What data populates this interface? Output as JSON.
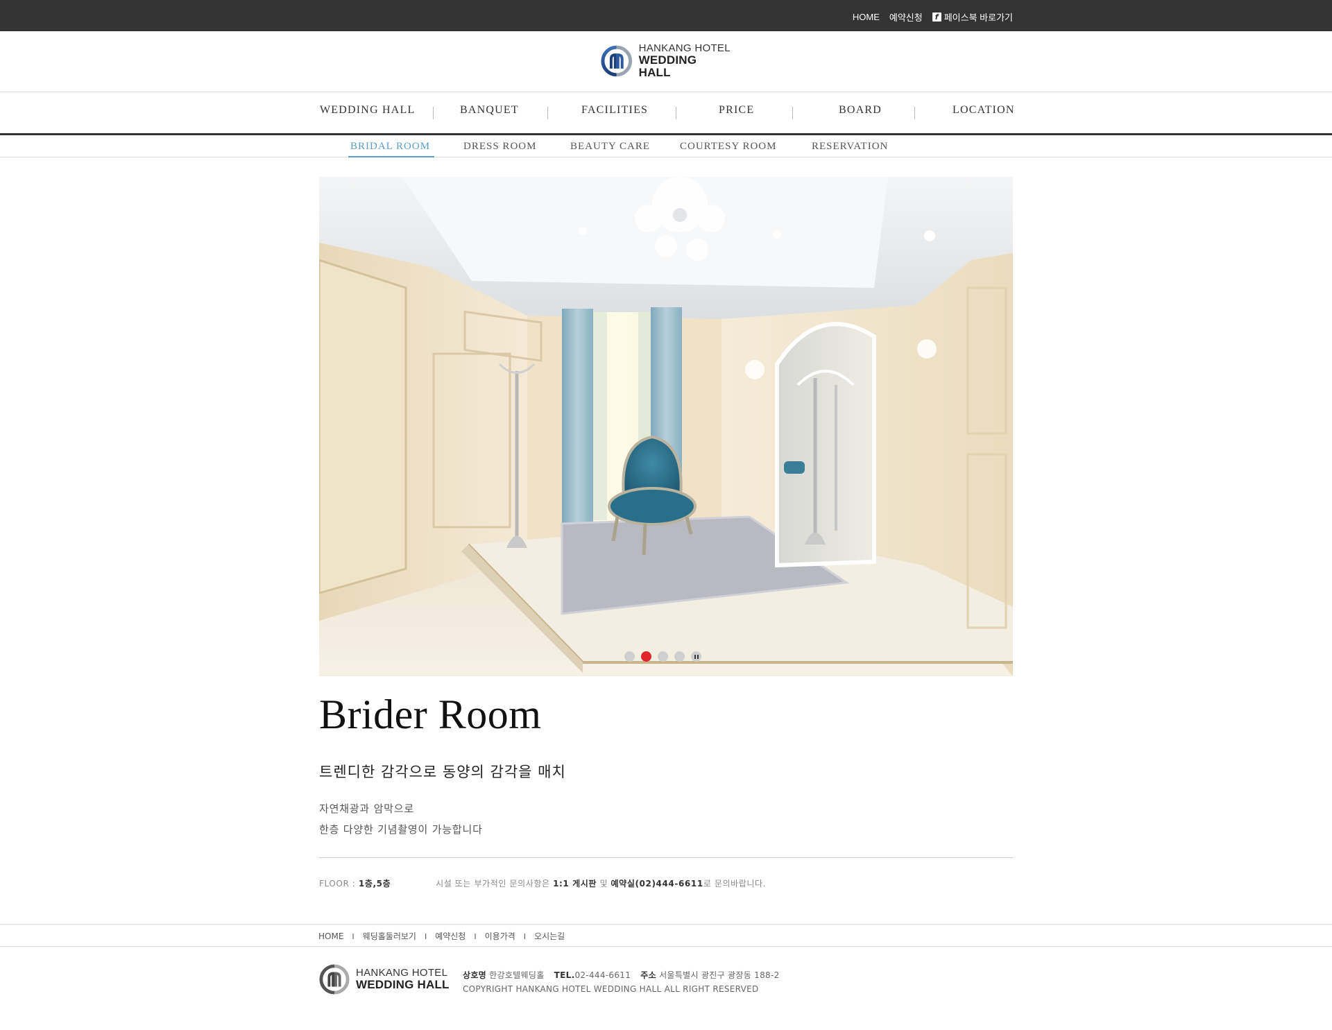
{
  "topbar": {
    "home": "HOME",
    "reservation": "예약신청",
    "facebook_icon": "f",
    "facebook": "페이스북 바로가기"
  },
  "brand": {
    "line1": "HANKANG HOTEL",
    "line2": "WEDDING HALL"
  },
  "main_nav": [
    "WEDDING HALL",
    "BANQUET",
    "FACILITIES",
    "PRICE",
    "BOARD",
    "LOCATION"
  ],
  "sub_nav": {
    "items": [
      "BRIDAL ROOM",
      "DRESS ROOM",
      "BEAUTY CARE",
      "COURTESY ROOM",
      "RESERVATION"
    ],
    "active": "BRIDAL ROOM"
  },
  "slider": {
    "slide_count": 4,
    "active_index": 1
  },
  "content": {
    "title": "Brider Room",
    "subtitle": "트렌디한 감각으로 동양의 감각을 매치",
    "desc_line1": "자연채광과 암막으로",
    "desc_line2": "한층 다양한 기념촬영이 가능합니다"
  },
  "info": {
    "floor_label": "FLOOR :",
    "floor_value": "1층,5층",
    "inquiry_pre": "시설 또는 부가적인 문의사항은",
    "inquiry_board": "1:1 게시판",
    "inquiry_and": "및",
    "inquiry_phone": "예약실(02)444-6611",
    "inquiry_post": "로 문의바랍니다."
  },
  "footer": {
    "nav": [
      "HOME",
      "웨딩홀둘러보기",
      "예약신청",
      "이용가격",
      "오시는길"
    ],
    "separator": "I",
    "company_label": "상호명",
    "company_value": "한강호텔웨딩홀",
    "tel_label": "TEL.",
    "tel_value": "02-444-6611",
    "address_label": "주소",
    "address_value": "서울특별시 광진구 광장동 188-2",
    "copyright": "COPYRIGHT HANKANG HOTEL WEDDING HALL ALL RIGHT RESERVED"
  },
  "colors": {
    "topbar_bg": "#333333",
    "accent": "#5a9bc9",
    "slider_active": "#e0262c"
  }
}
